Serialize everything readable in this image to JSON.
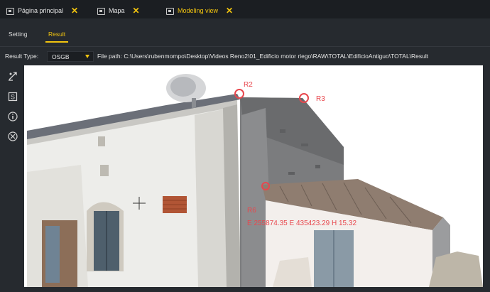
{
  "tabs": [
    {
      "label": "Página principal",
      "close": "✕"
    },
    {
      "label": "Mapa",
      "close": "✕"
    },
    {
      "label": "Modeling view",
      "close": "✕"
    }
  ],
  "subtabs": {
    "setting": "Setting",
    "result": "Result"
  },
  "result_row": {
    "label": "Result Type:",
    "type_value": "OSGB",
    "file_path": "File path: C:\\Users\\rubenmompo\\Desktop\\Videos Reno2\\01_Edificio motor riego\\RAW\\TOTAL\\EdificioAntiguo\\TOTAL\\Result"
  },
  "toolbar_icons": [
    "measure-point-icon",
    "s-box-icon",
    "info-icon",
    "clear-icon"
  ],
  "markers": {
    "r2": "R2",
    "r3": "R3",
    "r6": "R6",
    "coords": "E 255874.35 E 435423.29 H 15.32"
  },
  "colors": {
    "accent": "#f2c40f",
    "marker": "#e8474d",
    "panel": "#262a2f"
  }
}
